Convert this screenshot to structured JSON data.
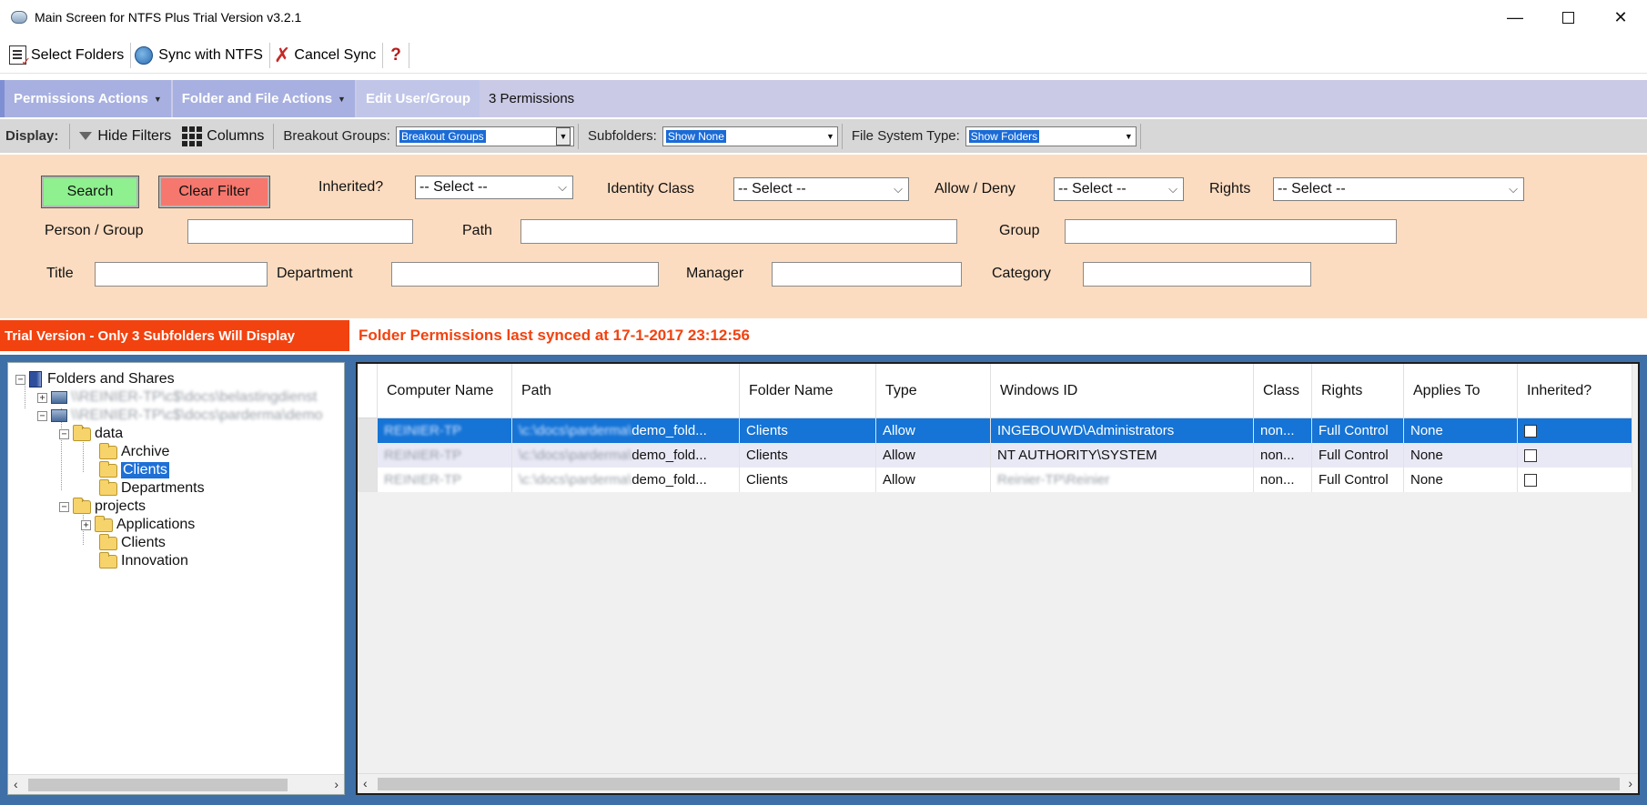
{
  "window": {
    "title": "Main Screen for NTFS Plus Trial Version v3.2.1",
    "minimize": "—",
    "close": "✕"
  },
  "toolbar": {
    "select_folders": "Select Folders",
    "sync_ntfs": "Sync with NTFS",
    "cancel_sync": "Cancel Sync",
    "help": "?"
  },
  "menubar": {
    "permissions_actions": "Permissions Actions",
    "folder_file_actions": "Folder and File Actions",
    "edit_user_group": "Edit User/Group",
    "permission_count": "3 Permissions"
  },
  "displaybar": {
    "label": "Display:",
    "hide_filters": "Hide Filters",
    "columns": "Columns",
    "breakout_label": "Breakout Groups:",
    "breakout_value": "Breakout Groups",
    "subfolders_label": "Subfolders:",
    "subfolders_value": "Show None",
    "fs_type_label": "File System Type:",
    "fs_type_value": "Show Folders"
  },
  "filters": {
    "search": "Search",
    "clear": "Clear Filter",
    "inherited_label": "Inherited?",
    "inherited_value": "-- Select --",
    "identity_label": "Identity Class",
    "identity_value": "-- Select --",
    "allow_label": "Allow / Deny",
    "allow_value": "-- Select --",
    "rights_label": "Rights",
    "rights_value": "-- Select --",
    "person_label": "Person / Group",
    "path_label": "Path",
    "group_label": "Group",
    "title_label": "Title",
    "department_label": "Department",
    "manager_label": "Manager",
    "category_label": "Category"
  },
  "status": {
    "trial": "Trial Version - Only 3 Subfolders Will Display",
    "synced": "Folder Permissions last synced at 17-1-2017 23:12:56"
  },
  "tree": {
    "root": "Folders and Shares",
    "share1": "\\\\REINIER-TP\\c$\\docs\\belastingdienst",
    "share2": "\\\\REINIER-TP\\c$\\docs\\parderma\\demo",
    "data": "data",
    "archive": "Archive",
    "clients": "Clients",
    "departments": "Departments",
    "projects": "projects",
    "applications": "Applications",
    "clients2": "Clients",
    "innovation": "Innovation"
  },
  "grid": {
    "columns": [
      "Computer Name",
      "Path",
      "Folder Name",
      "Type",
      "Windows ID",
      "Class",
      "Rights",
      "Applies To",
      "Inherited?"
    ],
    "rows": [
      {
        "computer": "REINIER-TP",
        "path_blur": "\\c:\\docs\\parderma\\",
        "path": "demo_fold...",
        "folder": "Clients",
        "type": "Allow",
        "winid": "INGEBOUWD\\Administrators",
        "class": "non...",
        "rights": "Full Control",
        "applies": "None"
      },
      {
        "computer": "REINIER-TP",
        "path_blur": "\\c:\\docs\\parderma\\",
        "path": "demo_fold...",
        "folder": "Clients",
        "type": "Allow",
        "winid": "NT AUTHORITY\\SYSTEM",
        "class": "non...",
        "rights": "Full Control",
        "applies": "None"
      },
      {
        "computer": "REINIER-TP",
        "path_blur": "\\c:\\docs\\parderma\\",
        "path": "demo_fold...",
        "folder": "Clients",
        "type": "Allow",
        "winid": "Reinier-TP\\Reinier",
        "class": "non...",
        "rights": "Full Control",
        "applies": "None"
      }
    ]
  },
  "colors": {
    "menubar": "#cacae6",
    "filters_bg": "#fcdcc0",
    "trial_bg": "#f2420f",
    "selection": "#1574d6",
    "main_bg": "#3e6fa6"
  }
}
